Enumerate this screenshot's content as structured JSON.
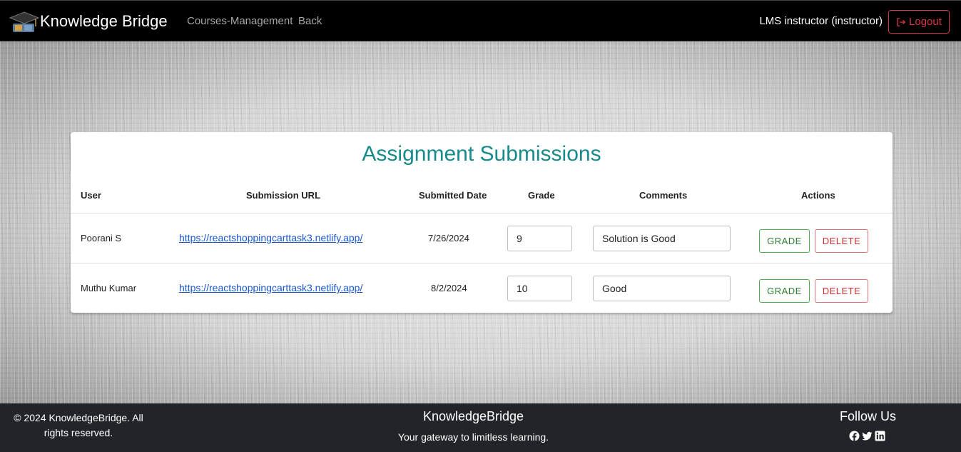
{
  "navbar": {
    "brand": "Knowledge Bridge",
    "links": [
      "Courses-Management",
      "Back"
    ],
    "user": "LMS instructor (instructor)",
    "logout_label": "Logout"
  },
  "card": {
    "title": "Assignment Submissions",
    "columns": [
      "User",
      "Submission URL",
      "Submitted Date",
      "Grade",
      "Comments",
      "Actions"
    ],
    "rows": [
      {
        "user": "Poorani S",
        "url": "https://reactshoppingcarttask3.netlify.app/",
        "date": "7/26/2024",
        "grade": "9",
        "comment": "Solution is Good",
        "grade_label": "GRADE",
        "delete_label": "DELETE"
      },
      {
        "user": "Muthu Kumar",
        "url": "https://reactshoppingcarttask3.netlify.app/",
        "date": "8/2/2024",
        "grade": "10",
        "comment": "Good",
        "grade_label": "GRADE",
        "delete_label": "DELETE"
      }
    ]
  },
  "footer": {
    "copyright": "© 2024 KnowledgeBridge. All rights reserved.",
    "brand": "KnowledgeBridge",
    "tagline": "Your gateway to limitless learning.",
    "follow": "Follow Us",
    "social_icons": [
      "facebook-icon",
      "twitter-icon",
      "linkedin-icon"
    ]
  },
  "colors": {
    "accent": "#178a8a",
    "logout": "#dc3545",
    "grade_btn": "#2e7d32",
    "delete_btn": "#d32f2f",
    "link": "#1a56c9"
  }
}
